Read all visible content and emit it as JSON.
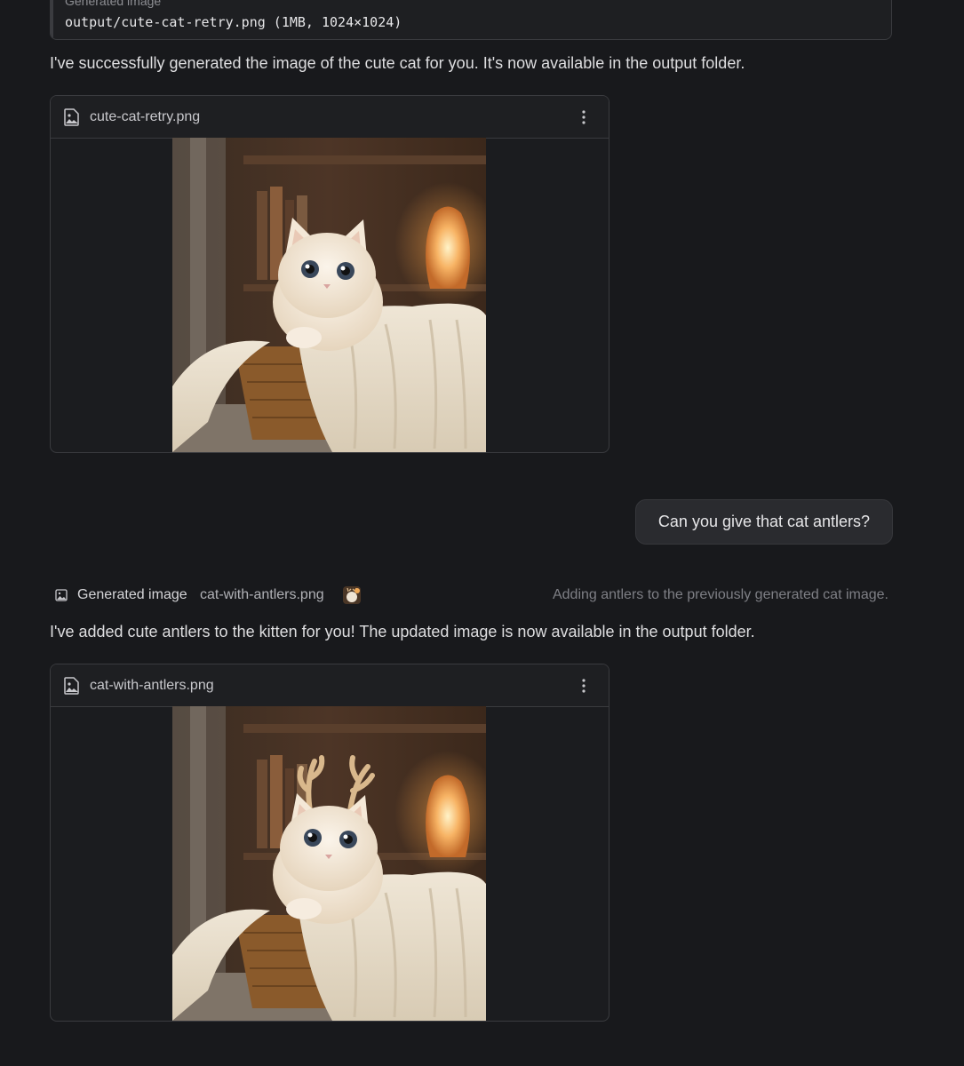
{
  "prev_tool": {
    "caption": "Generated image",
    "path": "output/cute-cat-retry.png (1MB, 1024×1024)"
  },
  "assistant_message_1": "I've successfully generated the image of the cute cat for you. It's now available in the output folder.",
  "image_card_1": {
    "filename": "cute-cat-retry.png",
    "file_icon": "image-file-icon",
    "menu_icon": "kebab-menu-icon",
    "has_antlers": false
  },
  "user_message": "Can you give that cat antlers?",
  "tool_status": {
    "icon": "image-icon",
    "label": "Generated image",
    "filename": "cat-with-antlers.png",
    "description": "Adding antlers to the previously generated cat image."
  },
  "assistant_message_2": "I've added cute antlers to the kitten for you! The updated image is now available in the output folder.",
  "image_card_2": {
    "filename": "cat-with-antlers.png",
    "file_icon": "image-file-icon",
    "menu_icon": "kebab-menu-icon",
    "has_antlers": true
  },
  "colors": {
    "background": "#18191c",
    "card_border": "#3a3b3f",
    "user_bubble": "#2a2b2f",
    "muted_text": "#7e7f85"
  }
}
